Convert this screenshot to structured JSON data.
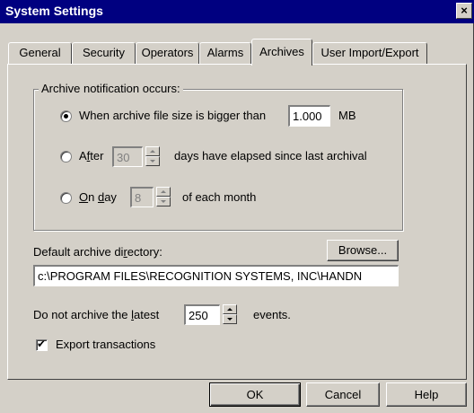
{
  "window": {
    "title": "System Settings",
    "close_glyph": "×"
  },
  "tabs": [
    {
      "label": "General",
      "active": false
    },
    {
      "label": "Security",
      "active": false
    },
    {
      "label": "Operators",
      "active": false
    },
    {
      "label": "Alarms",
      "active": false
    },
    {
      "label": "Archives",
      "active": true
    },
    {
      "label": "User Import/Export",
      "active": false
    }
  ],
  "notification": {
    "group_label": "Archive notification occurs:",
    "option_size": {
      "label": "When archive file size is bigger than",
      "value": "1.000",
      "unit": "MB",
      "selected": true
    },
    "option_days": {
      "label_prefix": "A",
      "label_accel": "f",
      "label_rest": "ter",
      "value": "30",
      "suffix": "days have elapsed since last archival",
      "selected": false
    },
    "option_day": {
      "label_accel": "O",
      "label_mid": "n ",
      "label_accel2": "d",
      "label_rest": "ay",
      "value": "8",
      "suffix": "of each month",
      "selected": false
    }
  },
  "directory": {
    "label_prefix": "Default archive di",
    "label_accel": "r",
    "label_rest": "ectory:",
    "browse_label": "Browse...",
    "path": "c:\\PROGRAM FILES\\RECOGNITION SYSTEMS, INC\\HANDN"
  },
  "latest": {
    "label_prefix": "Do not archive the ",
    "label_accel": "l",
    "label_rest": "atest",
    "value": "250",
    "suffix": "events."
  },
  "export": {
    "label": "Export transactions",
    "checked": true,
    "check_glyph": "✔"
  },
  "buttons": {
    "ok": "OK",
    "cancel": "Cancel",
    "help": "Help"
  },
  "colors": {
    "titlebar": "#000080",
    "face": "#d4d0c8"
  }
}
